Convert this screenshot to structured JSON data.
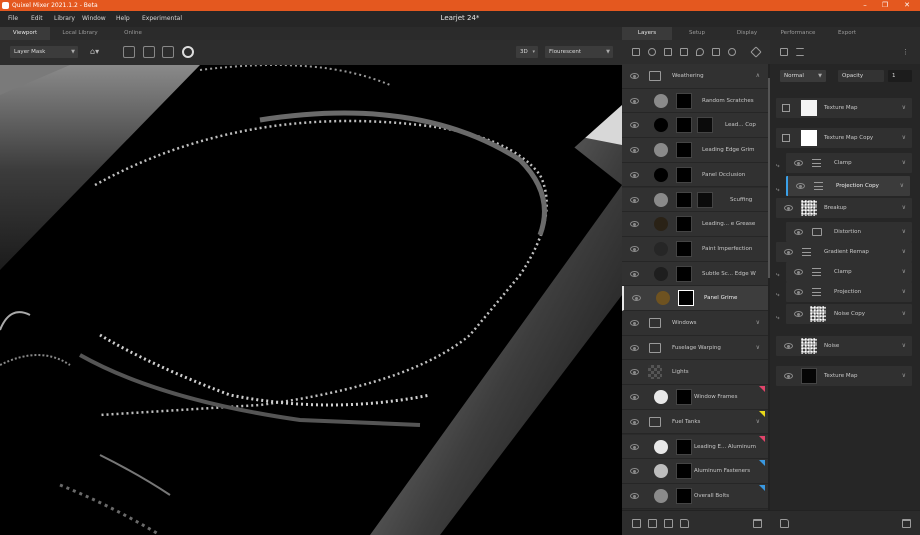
{
  "titlebar": {
    "app_title": "Quixel Mixer 2021.1.2 - Beta",
    "brand_color": "#e4581f"
  },
  "menubar": {
    "items": [
      "File",
      "Edit",
      "Library",
      "Window",
      "Help",
      "Experimental"
    ],
    "document_title": "Learjet 24*"
  },
  "left_tabs": [
    "Viewport",
    "Local Library",
    "Online"
  ],
  "right_tabs": [
    "Layers",
    "Setup",
    "Display",
    "Performance",
    "Export"
  ],
  "viewport_toolbar": {
    "mask_mode": "Layer Mask",
    "view_mode": "3D",
    "lighting": "Flourescent"
  },
  "layers": [
    {
      "name": "Weathering",
      "kind": "folder",
      "expanded": true
    },
    {
      "name": "Random Scratches",
      "kind": "layer",
      "circle": "#8a8a8a"
    },
    {
      "name": "Lead... Cop",
      "kind": "layer",
      "circle": "#000000",
      "extra_thumb": true
    },
    {
      "name": "Leading Edge Grim",
      "kind": "layer",
      "circle": "#8a8a8a"
    },
    {
      "name": "Panel Occlusion",
      "kind": "layer",
      "circle": "#000000"
    },
    {
      "name": "Scuffing",
      "kind": "layer",
      "circle": "#8a8a8a",
      "extra_thumb": true
    },
    {
      "name": "Leading... e Grease",
      "kind": "layer",
      "circle": "#2a2216"
    },
    {
      "name": "Paint Imperfection",
      "kind": "layer",
      "circle": "#262626"
    },
    {
      "name": "Subtle Sc... Edge W",
      "kind": "layer",
      "circle": "#1e1e1e"
    },
    {
      "name": "Panel Grime",
      "kind": "layer",
      "circle": "#6e5220",
      "selected": true
    },
    {
      "name": "Windows",
      "kind": "folder",
      "expanded": false
    },
    {
      "name": "Fuselage Warping",
      "kind": "folder",
      "expanded": false
    },
    {
      "name": "Lights",
      "kind": "checker"
    },
    {
      "name": "Window Frames",
      "kind": "layer",
      "circle": "#e8e8e8",
      "flag": "#e0446a"
    },
    {
      "name": "Fuel Tanks",
      "kind": "folder",
      "expanded": false,
      "flag": "#e8d81a"
    },
    {
      "name": "Leading E... Aluminum",
      "kind": "layer",
      "circle": "#e8e8e8",
      "flag": "#e0446a"
    },
    {
      "name": "Aluminum Fasteners",
      "kind": "layer",
      "circle": "#bdbdbd",
      "flag": "#3a98e0"
    },
    {
      "name": "Overall Bolts",
      "kind": "layer",
      "circle": "#8a8a8a",
      "flag": "#3a98e0"
    }
  ],
  "properties": {
    "blend_mode": "Normal",
    "opacity_label": "Opacity",
    "opacity_value": "1",
    "stack": [
      {
        "name": "Texture Map",
        "kind": "checkbox-thumb"
      },
      {
        "name": "Texture Map Copy",
        "kind": "checkbox-thumb"
      },
      {
        "name": "Clamp",
        "kind": "adjust",
        "indent": 1
      },
      {
        "name": "Projection Copy",
        "kind": "adjust",
        "indent": 1,
        "selected": true
      },
      {
        "name": "Breakup",
        "kind": "noise-thumb"
      },
      {
        "name": "Distortion",
        "kind": "folder",
        "indent": 1
      },
      {
        "name": "Gradient Remap",
        "kind": "adjust"
      },
      {
        "name": "Clamp",
        "kind": "adjust",
        "indent": 1
      },
      {
        "name": "Projection",
        "kind": "adjust",
        "indent": 1
      },
      {
        "name": "Noise Copy",
        "kind": "noise-thumb",
        "indent": 1
      },
      {
        "name": "Noise",
        "kind": "noise-thumb"
      },
      {
        "name": "Texture Map",
        "kind": "dark-thumb"
      }
    ]
  }
}
